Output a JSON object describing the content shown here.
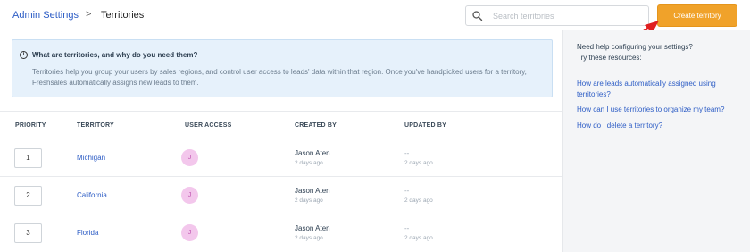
{
  "header": {
    "breadcrumb_parent": "Admin Settings",
    "breadcrumb_separator": ">",
    "breadcrumb_current": "Territories",
    "search_placeholder": "Search territories",
    "create_label": "Create territory"
  },
  "info": {
    "title": "What are territories, and why do you need them?",
    "body": "Territories help you group your users by sales regions, and control user access to leads' data within that region. Once you've handpicked users for a territory, Freshsales automatically assigns new leads to them."
  },
  "table": {
    "columns": [
      "PRIORITY",
      "TERRITORY",
      "USER ACCESS",
      "CREATED BY",
      "UPDATED BY"
    ],
    "rows": [
      {
        "priority": "1",
        "territory": "Michigan",
        "avatar": "J",
        "created_by": "Jason Aten",
        "created_at": "2 days ago",
        "updated_by": "--",
        "updated_at": "2 days ago"
      },
      {
        "priority": "2",
        "territory": "California",
        "avatar": "J",
        "created_by": "Jason Aten",
        "created_at": "2 days ago",
        "updated_by": "--",
        "updated_at": "2 days ago"
      },
      {
        "priority": "3",
        "territory": "Florida",
        "avatar": "J",
        "created_by": "Jason Aten",
        "created_at": "2 days ago",
        "updated_by": "--",
        "updated_at": "2 days ago"
      }
    ]
  },
  "sidebar": {
    "help_line1": "Need help configuring your settings?",
    "help_line2": "Try these resources:",
    "links": [
      "How are leads automatically assigned using territories?",
      "How can I use territories to organize my team?",
      "How do I delete a territory?"
    ]
  },
  "colors": {
    "accent": "#f0a22a",
    "link": "#2c5cc5",
    "info_bg": "#e6f1fb",
    "avatar_bg": "#f3c7ec",
    "annotation_arrow": "#e02020"
  },
  "icons": {
    "search": "search-icon",
    "info": "info-icon"
  }
}
